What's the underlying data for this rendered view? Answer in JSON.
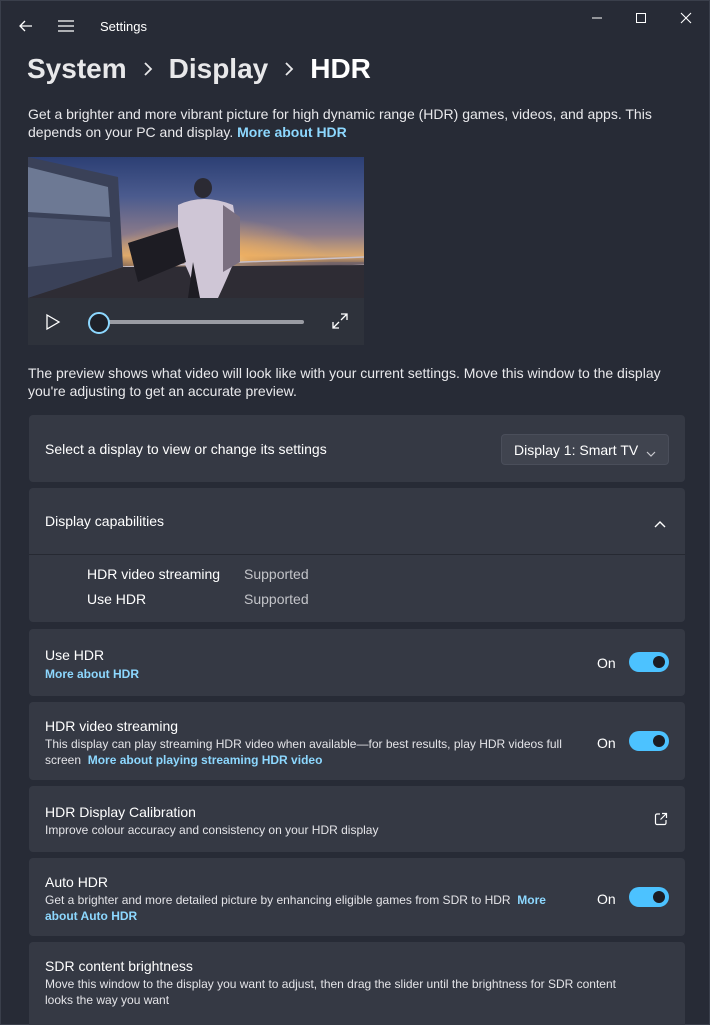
{
  "titlebar": {
    "title": "Settings",
    "back_icon": "back-arrow-icon",
    "menu_icon": "hamburger-menu-icon"
  },
  "breadcrumb": {
    "items": [
      "System",
      "Display",
      "HDR"
    ]
  },
  "intro": {
    "text": "Get a brighter and more vibrant picture for high dynamic range (HDR) games, videos, and apps. This depends on your PC and display.",
    "link": "More about HDR"
  },
  "video": {
    "progress": 0
  },
  "preview_note": "The preview shows what video will look like with your current settings. Move this window to the display you're adjusting to get an accurate preview.",
  "display_select": {
    "label": "Select a display to view or change its settings",
    "value": "Display 1: Smart TV"
  },
  "capabilities": {
    "title": "Display capabilities",
    "rows": [
      {
        "label": "HDR video streaming",
        "value": "Supported"
      },
      {
        "label": "Use HDR",
        "value": "Supported"
      }
    ]
  },
  "use_hdr": {
    "title": "Use HDR",
    "link": "More about HDR",
    "state": "On",
    "on": true
  },
  "hdr_video_streaming": {
    "title": "HDR video streaming",
    "desc": "This display can play streaming HDR video when available—for best results, play HDR videos full screen",
    "link": "More about playing streaming HDR video",
    "state": "On",
    "on": true
  },
  "calibration": {
    "title": "HDR Display Calibration",
    "desc": "Improve colour accuracy and consistency on your HDR display"
  },
  "auto_hdr": {
    "title": "Auto HDR",
    "desc": "Get a brighter and more detailed picture by enhancing eligible games from SDR to HDR",
    "link": "More about Auto HDR",
    "state": "On",
    "on": true
  },
  "sdr_brightness": {
    "title": "SDR content brightness",
    "desc": "Move this window to the display you want to adjust, then drag the slider until the brightness for SDR content looks the way you want"
  },
  "colors": {
    "accent": "#4cc2ff",
    "link": "#8dd8ff",
    "background": "#272b36",
    "card": "#353944"
  }
}
